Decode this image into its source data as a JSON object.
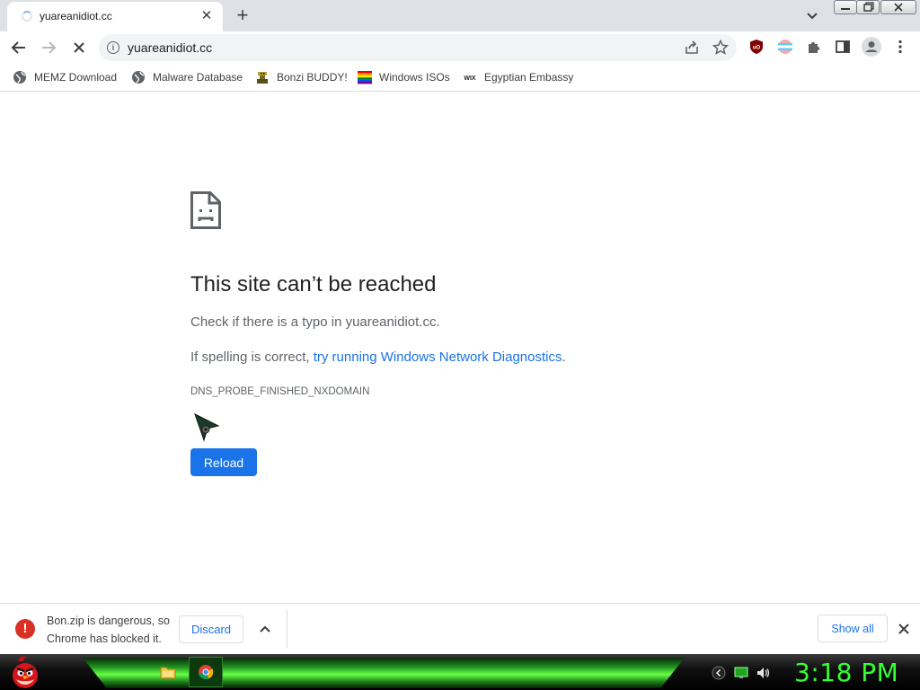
{
  "tab": {
    "title": "yuareanidiot.cc"
  },
  "toolbar": {
    "url": "yuareanidiot.cc"
  },
  "bookmarks": [
    {
      "label": "MEMZ Download",
      "icon": "globe-icon"
    },
    {
      "label": "Malware Database",
      "icon": "globe-icon"
    },
    {
      "label": "Bonzi BUDDY!",
      "icon": "bonzi-icon"
    },
    {
      "label": "Windows ISOs",
      "icon": "rainbow-flag-icon"
    },
    {
      "label": "Egyptian Embassy",
      "icon": "wix-icon"
    }
  ],
  "error": {
    "title": "This site can’t be reached",
    "text1": "Check if there is a typo in yuareanidiot.cc.",
    "text2_prefix": "If spelling is correct, ",
    "text2_link": "try running Windows Network Diagnostics",
    "text2_suffix": ".",
    "code": "DNS_PROBE_FINISHED_NXDOMAIN",
    "reload_label": "Reload"
  },
  "download": {
    "line1": "Bon.zip is dangerous, so",
    "line2": "Chrome has blocked it.",
    "discard_label": "Discard",
    "show_all_label": "Show all"
  },
  "taskbar": {
    "clock": "3:18 PM"
  },
  "colors": {
    "accent": "#1a73e8",
    "danger": "#d93025",
    "clock": "#33ff33"
  }
}
